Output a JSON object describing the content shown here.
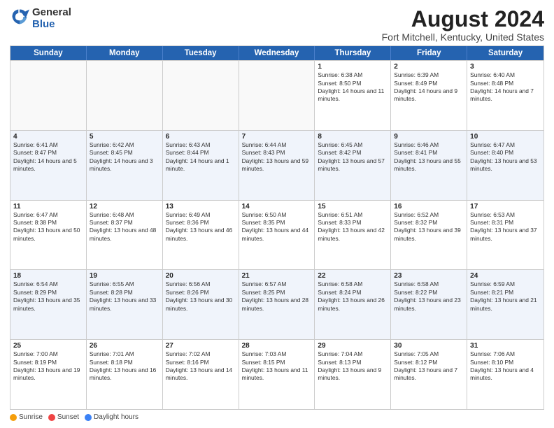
{
  "header": {
    "logo_general": "General",
    "logo_blue": "Blue",
    "title": "August 2024",
    "subtitle": "Fort Mitchell, Kentucky, United States"
  },
  "calendar": {
    "days_of_week": [
      "Sunday",
      "Monday",
      "Tuesday",
      "Wednesday",
      "Thursday",
      "Friday",
      "Saturday"
    ],
    "weeks": [
      [
        {
          "day": "",
          "sunrise": "",
          "sunset": "",
          "daylight": "",
          "empty": true
        },
        {
          "day": "",
          "sunrise": "",
          "sunset": "",
          "daylight": "",
          "empty": true
        },
        {
          "day": "",
          "sunrise": "",
          "sunset": "",
          "daylight": "",
          "empty": true
        },
        {
          "day": "",
          "sunrise": "",
          "sunset": "",
          "daylight": "",
          "empty": true
        },
        {
          "day": "1",
          "sunrise": "Sunrise: 6:38 AM",
          "sunset": "Sunset: 8:50 PM",
          "daylight": "Daylight: 14 hours and 11 minutes.",
          "empty": false
        },
        {
          "day": "2",
          "sunrise": "Sunrise: 6:39 AM",
          "sunset": "Sunset: 8:49 PM",
          "daylight": "Daylight: 14 hours and 9 minutes.",
          "empty": false
        },
        {
          "day": "3",
          "sunrise": "Sunrise: 6:40 AM",
          "sunset": "Sunset: 8:48 PM",
          "daylight": "Daylight: 14 hours and 7 minutes.",
          "empty": false
        }
      ],
      [
        {
          "day": "4",
          "sunrise": "Sunrise: 6:41 AM",
          "sunset": "Sunset: 8:47 PM",
          "daylight": "Daylight: 14 hours and 5 minutes.",
          "empty": false
        },
        {
          "day": "5",
          "sunrise": "Sunrise: 6:42 AM",
          "sunset": "Sunset: 8:45 PM",
          "daylight": "Daylight: 14 hours and 3 minutes.",
          "empty": false
        },
        {
          "day": "6",
          "sunrise": "Sunrise: 6:43 AM",
          "sunset": "Sunset: 8:44 PM",
          "daylight": "Daylight: 14 hours and 1 minute.",
          "empty": false
        },
        {
          "day": "7",
          "sunrise": "Sunrise: 6:44 AM",
          "sunset": "Sunset: 8:43 PM",
          "daylight": "Daylight: 13 hours and 59 minutes.",
          "empty": false
        },
        {
          "day": "8",
          "sunrise": "Sunrise: 6:45 AM",
          "sunset": "Sunset: 8:42 PM",
          "daylight": "Daylight: 13 hours and 57 minutes.",
          "empty": false
        },
        {
          "day": "9",
          "sunrise": "Sunrise: 6:46 AM",
          "sunset": "Sunset: 8:41 PM",
          "daylight": "Daylight: 13 hours and 55 minutes.",
          "empty": false
        },
        {
          "day": "10",
          "sunrise": "Sunrise: 6:47 AM",
          "sunset": "Sunset: 8:40 PM",
          "daylight": "Daylight: 13 hours and 53 minutes.",
          "empty": false
        }
      ],
      [
        {
          "day": "11",
          "sunrise": "Sunrise: 6:47 AM",
          "sunset": "Sunset: 8:38 PM",
          "daylight": "Daylight: 13 hours and 50 minutes.",
          "empty": false
        },
        {
          "day": "12",
          "sunrise": "Sunrise: 6:48 AM",
          "sunset": "Sunset: 8:37 PM",
          "daylight": "Daylight: 13 hours and 48 minutes.",
          "empty": false
        },
        {
          "day": "13",
          "sunrise": "Sunrise: 6:49 AM",
          "sunset": "Sunset: 8:36 PM",
          "daylight": "Daylight: 13 hours and 46 minutes.",
          "empty": false
        },
        {
          "day": "14",
          "sunrise": "Sunrise: 6:50 AM",
          "sunset": "Sunset: 8:35 PM",
          "daylight": "Daylight: 13 hours and 44 minutes.",
          "empty": false
        },
        {
          "day": "15",
          "sunrise": "Sunrise: 6:51 AM",
          "sunset": "Sunset: 8:33 PM",
          "daylight": "Daylight: 13 hours and 42 minutes.",
          "empty": false
        },
        {
          "day": "16",
          "sunrise": "Sunrise: 6:52 AM",
          "sunset": "Sunset: 8:32 PM",
          "daylight": "Daylight: 13 hours and 39 minutes.",
          "empty": false
        },
        {
          "day": "17",
          "sunrise": "Sunrise: 6:53 AM",
          "sunset": "Sunset: 8:31 PM",
          "daylight": "Daylight: 13 hours and 37 minutes.",
          "empty": false
        }
      ],
      [
        {
          "day": "18",
          "sunrise": "Sunrise: 6:54 AM",
          "sunset": "Sunset: 8:29 PM",
          "daylight": "Daylight: 13 hours and 35 minutes.",
          "empty": false
        },
        {
          "day": "19",
          "sunrise": "Sunrise: 6:55 AM",
          "sunset": "Sunset: 8:28 PM",
          "daylight": "Daylight: 13 hours and 33 minutes.",
          "empty": false
        },
        {
          "day": "20",
          "sunrise": "Sunrise: 6:56 AM",
          "sunset": "Sunset: 8:26 PM",
          "daylight": "Daylight: 13 hours and 30 minutes.",
          "empty": false
        },
        {
          "day": "21",
          "sunrise": "Sunrise: 6:57 AM",
          "sunset": "Sunset: 8:25 PM",
          "daylight": "Daylight: 13 hours and 28 minutes.",
          "empty": false
        },
        {
          "day": "22",
          "sunrise": "Sunrise: 6:58 AM",
          "sunset": "Sunset: 8:24 PM",
          "daylight": "Daylight: 13 hours and 26 minutes.",
          "empty": false
        },
        {
          "day": "23",
          "sunrise": "Sunrise: 6:58 AM",
          "sunset": "Sunset: 8:22 PM",
          "daylight": "Daylight: 13 hours and 23 minutes.",
          "empty": false
        },
        {
          "day": "24",
          "sunrise": "Sunrise: 6:59 AM",
          "sunset": "Sunset: 8:21 PM",
          "daylight": "Daylight: 13 hours and 21 minutes.",
          "empty": false
        }
      ],
      [
        {
          "day": "25",
          "sunrise": "Sunrise: 7:00 AM",
          "sunset": "Sunset: 8:19 PM",
          "daylight": "Daylight: 13 hours and 19 minutes.",
          "empty": false
        },
        {
          "day": "26",
          "sunrise": "Sunrise: 7:01 AM",
          "sunset": "Sunset: 8:18 PM",
          "daylight": "Daylight: 13 hours and 16 minutes.",
          "empty": false
        },
        {
          "day": "27",
          "sunrise": "Sunrise: 7:02 AM",
          "sunset": "Sunset: 8:16 PM",
          "daylight": "Daylight: 13 hours and 14 minutes.",
          "empty": false
        },
        {
          "day": "28",
          "sunrise": "Sunrise: 7:03 AM",
          "sunset": "Sunset: 8:15 PM",
          "daylight": "Daylight: 13 hours and 11 minutes.",
          "empty": false
        },
        {
          "day": "29",
          "sunrise": "Sunrise: 7:04 AM",
          "sunset": "Sunset: 8:13 PM",
          "daylight": "Daylight: 13 hours and 9 minutes.",
          "empty": false
        },
        {
          "day": "30",
          "sunrise": "Sunrise: 7:05 AM",
          "sunset": "Sunset: 8:12 PM",
          "daylight": "Daylight: 13 hours and 7 minutes.",
          "empty": false
        },
        {
          "day": "31",
          "sunrise": "Sunrise: 7:06 AM",
          "sunset": "Sunset: 8:10 PM",
          "daylight": "Daylight: 13 hours and 4 minutes.",
          "empty": false
        }
      ]
    ]
  },
  "legend": {
    "sunrise": "Sunrise",
    "sunset": "Sunset",
    "daylight": "Daylight hours"
  },
  "accent_color": "#2563b0",
  "alt_row_color": "#e8eef8"
}
